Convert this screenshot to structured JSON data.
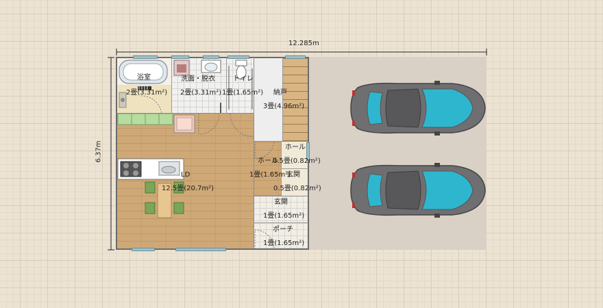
{
  "dimensions": {
    "width_label": "12.285m",
    "height_label": "6.37m"
  },
  "rooms": {
    "bath": {
      "name": "浴室",
      "size": "2畳(3.31m²)"
    },
    "wash": {
      "name": "洗面・脱衣",
      "size": "2畳(3.31m²)"
    },
    "toilet": {
      "name": "トイレ",
      "size": "1畳(1.65m²)"
    },
    "storage": {
      "name": "納戸",
      "size": "3畳(4.96m²)"
    },
    "hall_small": {
      "name": "ホール",
      "size": "0.5畳(0.82m²)"
    },
    "hall_main": {
      "name": "ホール",
      "size": "1畳(1.65m²)"
    },
    "entry_small": {
      "name": "玄関",
      "size": "0.5畳(0.82m²)"
    },
    "entry": {
      "name": "玄関",
      "size": "1畳(1.65m²)"
    },
    "porch": {
      "name": "ポーチ",
      "size": "1畳(1.65m²)"
    },
    "ldk": {
      "name": "LD",
      "size": "12.5畳(20.7m²)"
    }
  },
  "colors": {
    "wall": "#6b6b6b",
    "wood_floor": "#cfa877",
    "car_body": "#6f6f72",
    "car_glass": "#2fb6cf"
  }
}
